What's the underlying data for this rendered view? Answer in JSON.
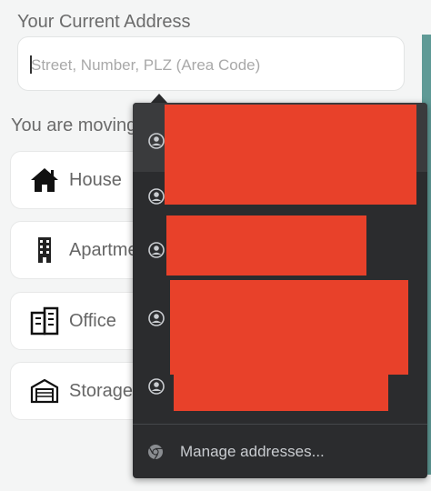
{
  "address": {
    "title": "Your Current Address",
    "placeholder": "Street, Number, PLZ (Area Code)"
  },
  "moving": {
    "title": "You are moving"
  },
  "types": [
    {
      "label": "House",
      "icon": "house-icon"
    },
    {
      "label": "Apartment",
      "icon": "apartment-icon"
    },
    {
      "label": "Office",
      "icon": "office-icon"
    },
    {
      "label": "Storage",
      "icon": "storage-icon"
    }
  ],
  "autocomplete": {
    "suggestion_icon": "person-icon",
    "suggestions_redacted": true,
    "manage_label": "Manage addresses...",
    "manage_icon": "chrome-icon",
    "redaction_color": "#e8412a",
    "background_color": "#2b2c2e"
  }
}
